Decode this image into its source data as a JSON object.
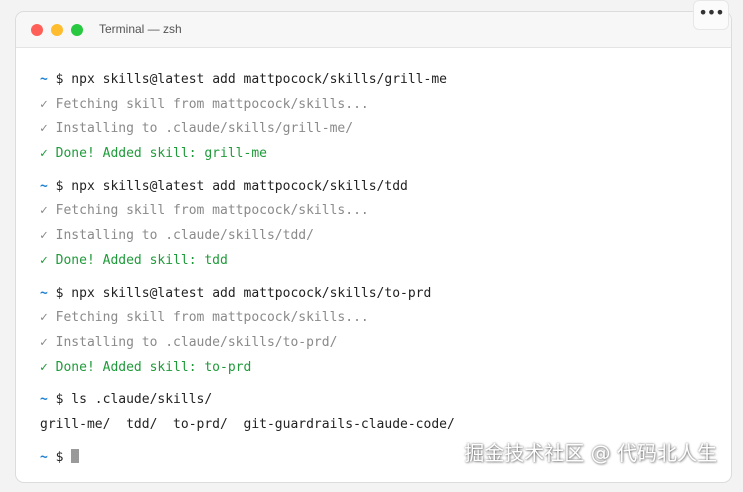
{
  "window": {
    "title": "Terminal — zsh",
    "more_label": "•••"
  },
  "terminal": {
    "prompt_symbol": "~",
    "prompt_char": "$",
    "lines": {
      "cmd1": " npx skills@latest add mattpocock/skills/grill-me",
      "fetch1": "✓ Fetching skill from mattpocock/skills...",
      "install1": "✓ Installing to .claude/skills/grill-me/",
      "done1": "✓ Done! Added skill: grill-me",
      "cmd2": " npx skills@latest add mattpocock/skills/tdd",
      "fetch2": "✓ Fetching skill from mattpocock/skills...",
      "install2": "✓ Installing to .claude/skills/tdd/",
      "done2": "✓ Done! Added skill: tdd",
      "cmd3": " npx skills@latest add mattpocock/skills/to-prd",
      "fetch3": "✓ Fetching skill from mattpocock/skills...",
      "install3": "✓ Installing to .claude/skills/to-prd/",
      "done3": "✓ Done! Added skill: to-prd",
      "cmd4": " ls .claude/skills/",
      "ls_output": "grill-me/  tdd/  to-prd/  git-guardrails-claude-code/"
    }
  },
  "watermark": "掘金技术社区 @ 代码北人生",
  "colors": {
    "prompt": "#1f7fd0",
    "success": "#1f9a3a",
    "muted": "#8a8a8a",
    "close": "#ff5f57",
    "minimize": "#febc2e",
    "zoom": "#28c840"
  }
}
